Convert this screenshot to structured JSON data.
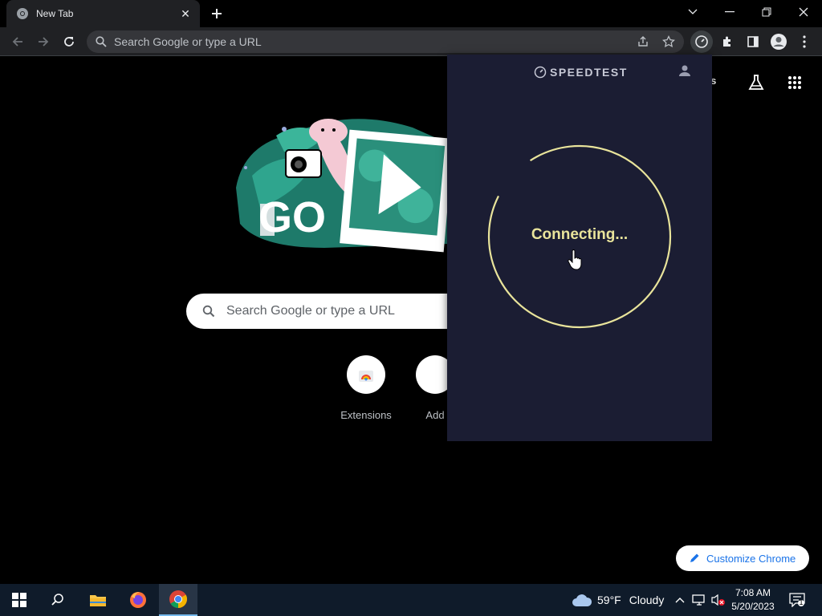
{
  "browser": {
    "tab_title": "New Tab",
    "omnibox_placeholder": "Search Google or type a URL"
  },
  "ntp": {
    "search_placeholder": "Search Google or type a URL",
    "images_link": "ges",
    "shortcuts": [
      {
        "label": "Extensions"
      },
      {
        "label": "Add"
      }
    ],
    "customize_label": "Customize Chrome"
  },
  "speedtest": {
    "logo": "SPEEDTEST",
    "status": "Connecting..."
  },
  "taskbar": {
    "temperature": "59°F",
    "condition": "Cloudy",
    "time": "7:08 AM",
    "date": "5/20/2023",
    "notification_count": "1"
  },
  "colors": {
    "popup_bg": "#1b1d33",
    "ring": "#e9e49b",
    "accent": "#1a73e8"
  }
}
